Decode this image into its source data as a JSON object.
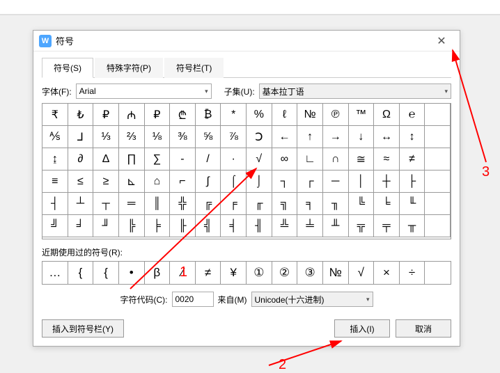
{
  "dialog": {
    "title": "符号",
    "tabs": [
      "符号(S)",
      "特殊字符(P)",
      "符号栏(T)"
    ],
    "font_label": "字体(F):",
    "font_value": "Arial",
    "subset_label": "子集(U):",
    "subset_value": "基本拉丁语",
    "grid": [
      "₹",
      "₺",
      "₽",
      "₼",
      "₽",
      "₾",
      "₿",
      "*",
      "%",
      "ℓ",
      "№",
      "℗",
      "™",
      "Ω",
      "℮",
      "⅍",
      "⅃",
      "⅓",
      "⅔",
      "⅛",
      "⅜",
      "⅝",
      "⅞",
      "Ↄ",
      "←",
      "↑",
      "→",
      "↓",
      "↔",
      "↕",
      "↨",
      "∂",
      "∆",
      "∏",
      "∑",
      "-",
      "/",
      "·",
      "√",
      "∞",
      "∟",
      "∩",
      "≅",
      "≈",
      "≠",
      "≡",
      "≤",
      "≥",
      "⊾",
      "⌂",
      "⌐",
      "∫",
      "⌠",
      "⌡",
      "┐",
      "┌",
      "─",
      "│",
      "┼",
      "├",
      "┤",
      "┴",
      "┬",
      "═",
      "║",
      "╬",
      "╔",
      "╒",
      "╓",
      "╗",
      "╕",
      "╖",
      "╚",
      "╘",
      "╙",
      "╝",
      "╛",
      "╜",
      "╠",
      "╞",
      "╟",
      "╣",
      "╡",
      "╢",
      "╩",
      "╧",
      "╨",
      "╦",
      "╤",
      "╥"
    ],
    "recent_label": "近期使用过的符号(R):",
    "recent": [
      "…",
      "{",
      "{",
      "•",
      "β",
      "∕",
      "≠",
      "¥",
      "①",
      "②",
      "③",
      "№",
      "√",
      "×",
      "÷"
    ],
    "code_label": "字符代码(C):",
    "code_value": "0020",
    "from_label": "来自(M)",
    "from_value": "Unicode(十六进制)",
    "insert_to_bar": "插入到符号栏(Y)",
    "insert": "插入(I)",
    "cancel": "取消"
  },
  "annotations": {
    "n1": "1",
    "n2": "2",
    "n3": "3"
  }
}
